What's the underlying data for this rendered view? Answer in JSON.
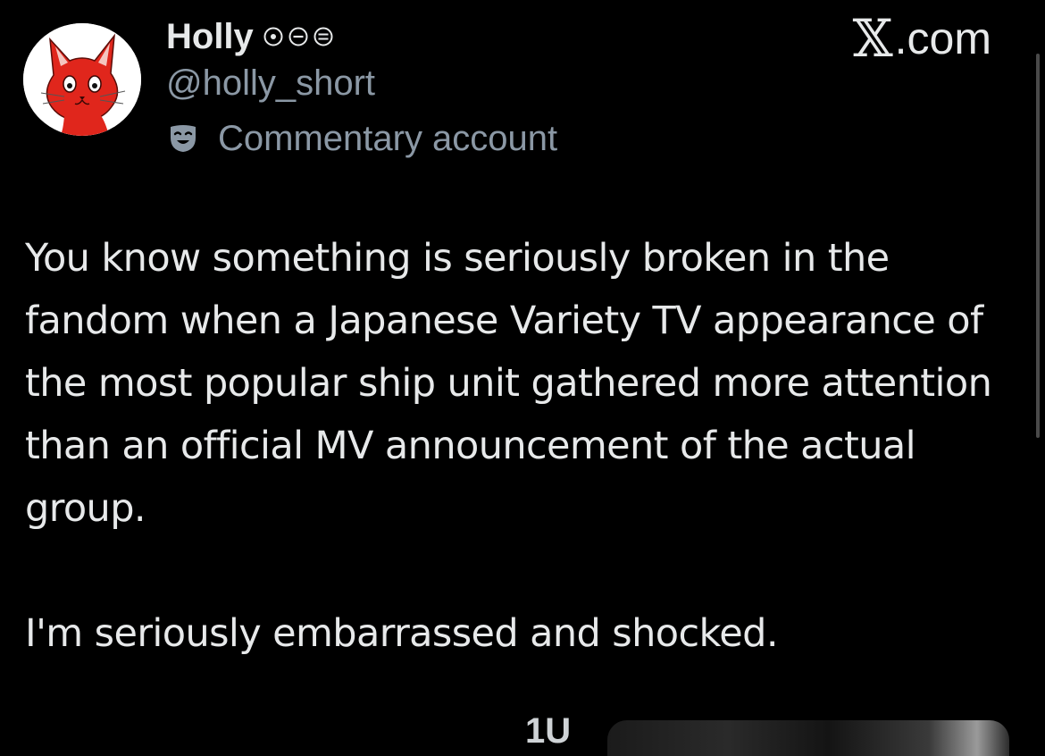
{
  "author": {
    "display_name": "Holly",
    "handle": "@holly_short",
    "account_label": "Commentary account",
    "avatar": "red-cat-avatar",
    "badges": [
      "circle-dot-icon",
      "circle-minus-icon",
      "circle-lines-icon"
    ],
    "label_icon": "theater-mask-icon"
  },
  "brand": {
    "text": "X.com",
    "x_glyph": "𝕏",
    "suffix": ".com"
  },
  "tweet": {
    "paragraphs": [
      "You know something is seriously broken in the fandom when a Japanese Variety TV appearance of the most popular ship unit gathered more attention than an official MV announcement of the actual group.",
      "I'm seriously embarrassed and shocked."
    ]
  },
  "media": {
    "partial_text": "1U"
  },
  "colors": {
    "background": "#000000",
    "primary_text": "#e7e9ea",
    "secondary_text": "#8b98a5",
    "avatar_red": "#e0261c"
  }
}
